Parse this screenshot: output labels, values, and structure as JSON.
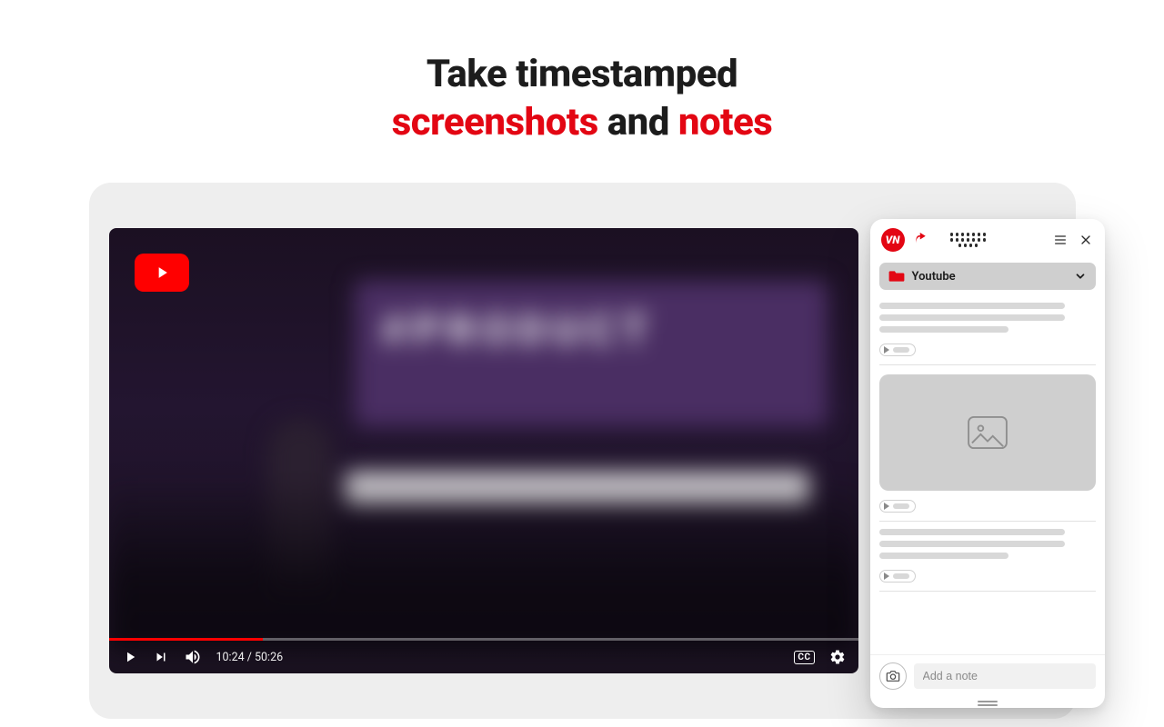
{
  "headline": {
    "part1": "Take timestamped",
    "part2_red_a": "screenshots",
    "part2_mid": " and ",
    "part2_red_b": "notes"
  },
  "player": {
    "yt_brand": "YouTube",
    "scene_text_big": "#PRODUCT",
    "scene_text_sub": "",
    "current_time": "10:24",
    "duration": "50:26",
    "time_sep": " / ",
    "cc_label": "CC"
  },
  "panel": {
    "brand_text": "VN",
    "folder_label": "Youtube",
    "note_placeholder": "Add a note"
  },
  "colors": {
    "accent_red": "#e30613",
    "yt_red": "#ff0000"
  }
}
